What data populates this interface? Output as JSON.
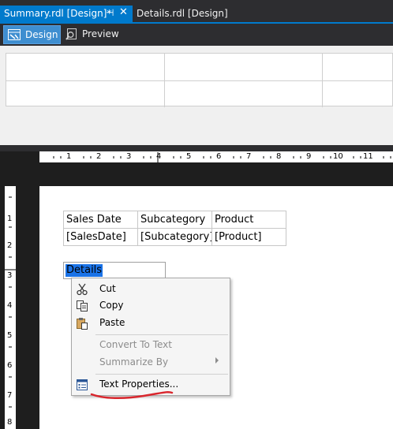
{
  "tabs": {
    "active": {
      "label": "Summary.rdl [Design]*",
      "pin": "⊣",
      "close": "✕"
    },
    "inactive": {
      "label": "Details.rdl [Design]"
    }
  },
  "toolbar": {
    "design_label": "Design",
    "preview_label": "Preview"
  },
  "ruler": {
    "horizontal": [
      "1",
      "2",
      "3",
      "4",
      "5",
      "6",
      "7",
      "8",
      "9",
      "10",
      "11"
    ],
    "vertical": [
      "1",
      "2",
      "3",
      "4",
      "5",
      "6",
      "7",
      "8"
    ]
  },
  "tablix": {
    "headers": [
      "Sales Date",
      "Subcategory",
      "Product"
    ],
    "fields": [
      "[SalesDate]",
      "[Subcategory]",
      "[Product]"
    ]
  },
  "details_textbox": {
    "text": "Details"
  },
  "context_menu": {
    "cut": "Cut",
    "copy": "Copy",
    "paste": "Paste",
    "convert_to_text": "Convert To Text",
    "summarize_by": "Summarize By",
    "text_properties": "Text Properties..."
  },
  "colors": {
    "accent": "#007acc",
    "annotation": "#d9262d"
  }
}
